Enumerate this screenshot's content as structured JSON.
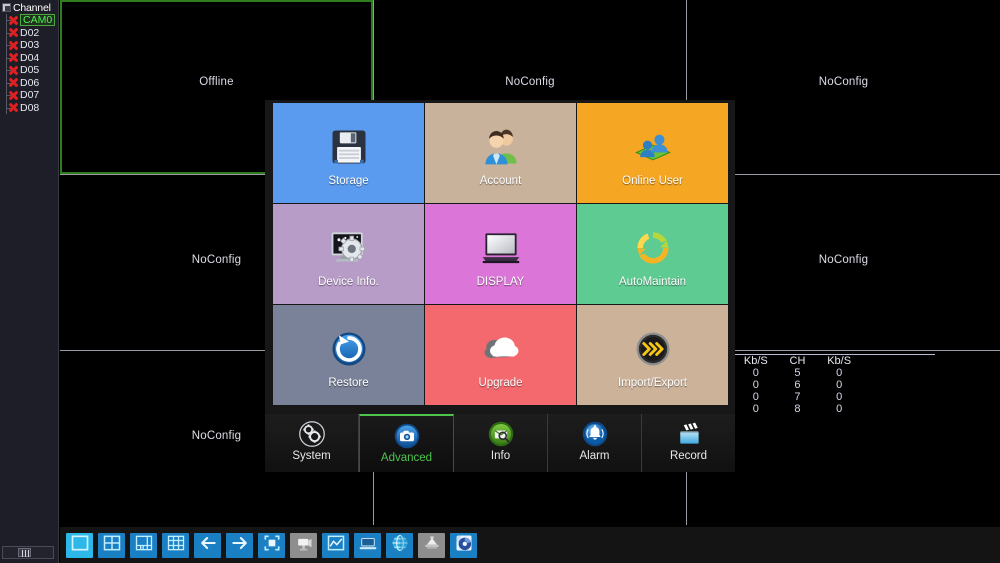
{
  "sidebar": {
    "header_label": "Channel",
    "header_icon": "tree-expand-icon",
    "channels": [
      {
        "name": "CAM0",
        "status_icon": "red-x-icon",
        "selected": true
      },
      {
        "name": "D02",
        "status_icon": "red-x-icon",
        "selected": false
      },
      {
        "name": "D03",
        "status_icon": "red-x-icon",
        "selected": false
      },
      {
        "name": "D04",
        "status_icon": "red-x-icon",
        "selected": false
      },
      {
        "name": "D05",
        "status_icon": "red-x-icon",
        "selected": false
      },
      {
        "name": "D06",
        "status_icon": "red-x-icon",
        "selected": false
      },
      {
        "name": "D07",
        "status_icon": "red-x-icon",
        "selected": false
      },
      {
        "name": "D08",
        "status_icon": "red-x-icon",
        "selected": false
      }
    ]
  },
  "video_grid": {
    "cells": [
      {
        "label": "Offline",
        "selected": true
      },
      {
        "label": "NoConfig",
        "selected": false
      },
      {
        "label": "NoConfig",
        "selected": false
      },
      {
        "label": "NoConfig",
        "selected": false
      },
      {
        "label": "",
        "selected": false
      },
      {
        "label": "NoConfig",
        "selected": false
      },
      {
        "label": "NoConfig",
        "selected": false
      },
      {
        "label": "",
        "selected": false
      },
      {
        "label": "",
        "selected": false
      }
    ]
  },
  "bitrate_panel": {
    "headers": [
      "Kb/S",
      "CH",
      "Kb/S"
    ],
    "rows": [
      [
        "0",
        "5",
        "0"
      ],
      [
        "0",
        "6",
        "0"
      ],
      [
        "0",
        "7",
        "0"
      ],
      [
        "0",
        "8",
        "0"
      ]
    ]
  },
  "menu": {
    "tiles": [
      {
        "label": "Storage",
        "icon": "floppy-disk-icon",
        "bg": "#5a9bf0"
      },
      {
        "label": "Account",
        "icon": "users-icon",
        "bg": "#c8b29c"
      },
      {
        "label": "Online User",
        "icon": "online-users-icon",
        "bg": "#f5a623"
      },
      {
        "label": "Device Info.",
        "icon": "device-info-icon",
        "bg": "#b89cc8"
      },
      {
        "label": "DISPLAY",
        "icon": "monitor-icon",
        "bg": "#db76d8"
      },
      {
        "label": "AutoMaintain",
        "icon": "refresh-icon",
        "bg": "#5ecb92"
      },
      {
        "label": "Restore",
        "icon": "restore-icon",
        "bg": "#7a8299"
      },
      {
        "label": "Upgrade",
        "icon": "cloud-upload-icon",
        "bg": "#f4696e"
      },
      {
        "label": "Import/Export",
        "icon": "chevrons-icon",
        "bg": "#cbb299"
      }
    ],
    "tabs": [
      {
        "label": "System",
        "icon": "gears-icon",
        "active": false
      },
      {
        "label": "Advanced",
        "icon": "camera-icon",
        "active": true
      },
      {
        "label": "Info",
        "icon": "search-mail-icon",
        "active": false
      },
      {
        "label": "Alarm",
        "icon": "bell-icon",
        "active": false
      },
      {
        "label": "Record",
        "icon": "clapper-icon",
        "active": false
      }
    ],
    "active_tab_color": "#4ec44e"
  },
  "toolbar": {
    "buttons": [
      {
        "icon": "single-view-icon",
        "style": "active"
      },
      {
        "icon": "quad-view-icon",
        "style": "blue"
      },
      {
        "icon": "six-view-icon",
        "style": "blue"
      },
      {
        "icon": "nine-view-icon",
        "style": "blue"
      },
      {
        "icon": "arrow-left-icon",
        "style": "blue"
      },
      {
        "icon": "arrow-right-icon",
        "style": "blue"
      },
      {
        "icon": "fullscreen-icon",
        "style": "blue"
      },
      {
        "icon": "ptz-camera-icon",
        "style": "gray"
      },
      {
        "icon": "color-adjust-icon",
        "style": "blue"
      },
      {
        "icon": "playback-icon",
        "style": "blue"
      },
      {
        "icon": "network-globe-icon",
        "style": "blue"
      },
      {
        "icon": "alarm-output-icon",
        "style": "gray"
      },
      {
        "icon": "disk-backup-icon",
        "style": "blue"
      }
    ]
  }
}
